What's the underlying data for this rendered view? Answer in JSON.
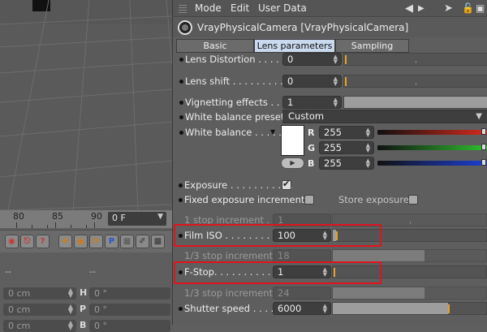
{
  "timeline": {
    "ticks": [
      "80",
      "85",
      "90"
    ],
    "frame_value": "0 F"
  },
  "coordinates": {
    "headers": [
      "--",
      "--"
    ],
    "rows": [
      {
        "left_value": "0 cm",
        "axis": "H",
        "right_value": "0 °"
      },
      {
        "left_value": "0 cm",
        "axis": "P",
        "right_value": "0 °"
      },
      {
        "left_value": "0 cm",
        "axis": "B",
        "right_value": "0 °"
      }
    ]
  },
  "menubar": {
    "items": [
      "Mode",
      "Edit",
      "User Data"
    ]
  },
  "object": {
    "title": "VrayPhysicalCamera [VrayPhysicalCamera]"
  },
  "tabs": [
    {
      "label": "Basic",
      "active": false
    },
    {
      "label": "Lens parameters",
      "active": true
    },
    {
      "label": "Sampling",
      "active": false
    }
  ],
  "params": {
    "lens_distortion": {
      "label": "Lens Distortion . . . . .",
      "value": "0"
    },
    "lens_shift": {
      "label": "Lens shift . . . . . . . . . .",
      "value": "0"
    },
    "vignetting": {
      "label": "Vignetting effects . .",
      "value": "1"
    },
    "wb_presets": {
      "label": "White balance presets",
      "value": "Custom"
    },
    "white_balance": {
      "label": "White balance . . . . .",
      "color": "#ffffff",
      "channels": [
        {
          "name": "R",
          "value": "255",
          "color": "#d42a1c"
        },
        {
          "name": "G",
          "value": "255",
          "color": "#2fbf2f"
        },
        {
          "name": "B",
          "value": "255",
          "color": "#1c3fd4"
        }
      ]
    },
    "exposure": {
      "label": "Exposure . . . . . . . . . . .",
      "checked": true
    },
    "fixed_exposure": {
      "label": "Fixed exposure increments",
      "checked": false
    },
    "store_exposure": {
      "label": "Store exposure",
      "checked": false
    },
    "stop_increment": {
      "label": "1 stop increment . . .",
      "value": "1"
    },
    "film_iso": {
      "label": "Film ISO . . . . . . . . . . .",
      "value": "100"
    },
    "third_stop_a": {
      "label": "1/3 stop increment",
      "value": "18"
    },
    "f_stop": {
      "label": "F-Stop. . . . . . . . . . . . .",
      "value": "1"
    },
    "third_stop_b": {
      "label": "1/3 stop increment",
      "value": "24"
    },
    "shutter_speed": {
      "label": "Shutter speed . . . . .",
      "value": "6000"
    }
  },
  "sliders": {
    "lens_distortion": 0.0,
    "lens_shift": 0.0,
    "vignetting": 1.0,
    "stop_increment": 0.0,
    "film_iso": 0.02,
    "third_stop_a": 0.6,
    "f_stop": 0.0,
    "third_stop_b": 0.6,
    "shutter_speed": 0.75
  }
}
